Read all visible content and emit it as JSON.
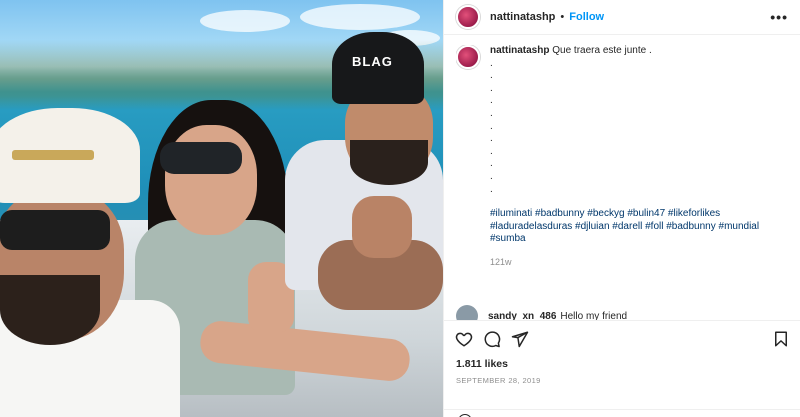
{
  "post": {
    "username": "nattinatashp",
    "separator": "•",
    "follow_label": "Follow",
    "more_label": "•••"
  },
  "caption": {
    "username": "nattinatashp",
    "text": "Que traera este junte .",
    "dots": [
      ".",
      ".",
      ".",
      ".",
      ".",
      ".",
      ".",
      ".",
      ".",
      ".",
      "."
    ],
    "hashtags_line1": "#iluminati #badbunny #beckyg #bulin47 #likeforlikes",
    "hashtags_line2": "#laduradelasduras #djluian #darell #foll #badbunny #mundial",
    "hashtags_line3": "#sumba",
    "timestamp": "121w"
  },
  "comment": {
    "username": "sandy_xn_486",
    "text": "Hello my friend"
  },
  "photo": {
    "cap_text": "BLAG"
  },
  "engagement": {
    "likes": "1.811 likes",
    "date": "SEPTEMBER 28, 2019"
  },
  "colors": {
    "follow": "#0095f6",
    "hashtag": "#00376b",
    "muted": "#8e8e8e"
  },
  "icons": [
    "heart-icon",
    "comment-icon",
    "share-icon",
    "bookmark-icon",
    "more-icon",
    "emoji-icon"
  ]
}
